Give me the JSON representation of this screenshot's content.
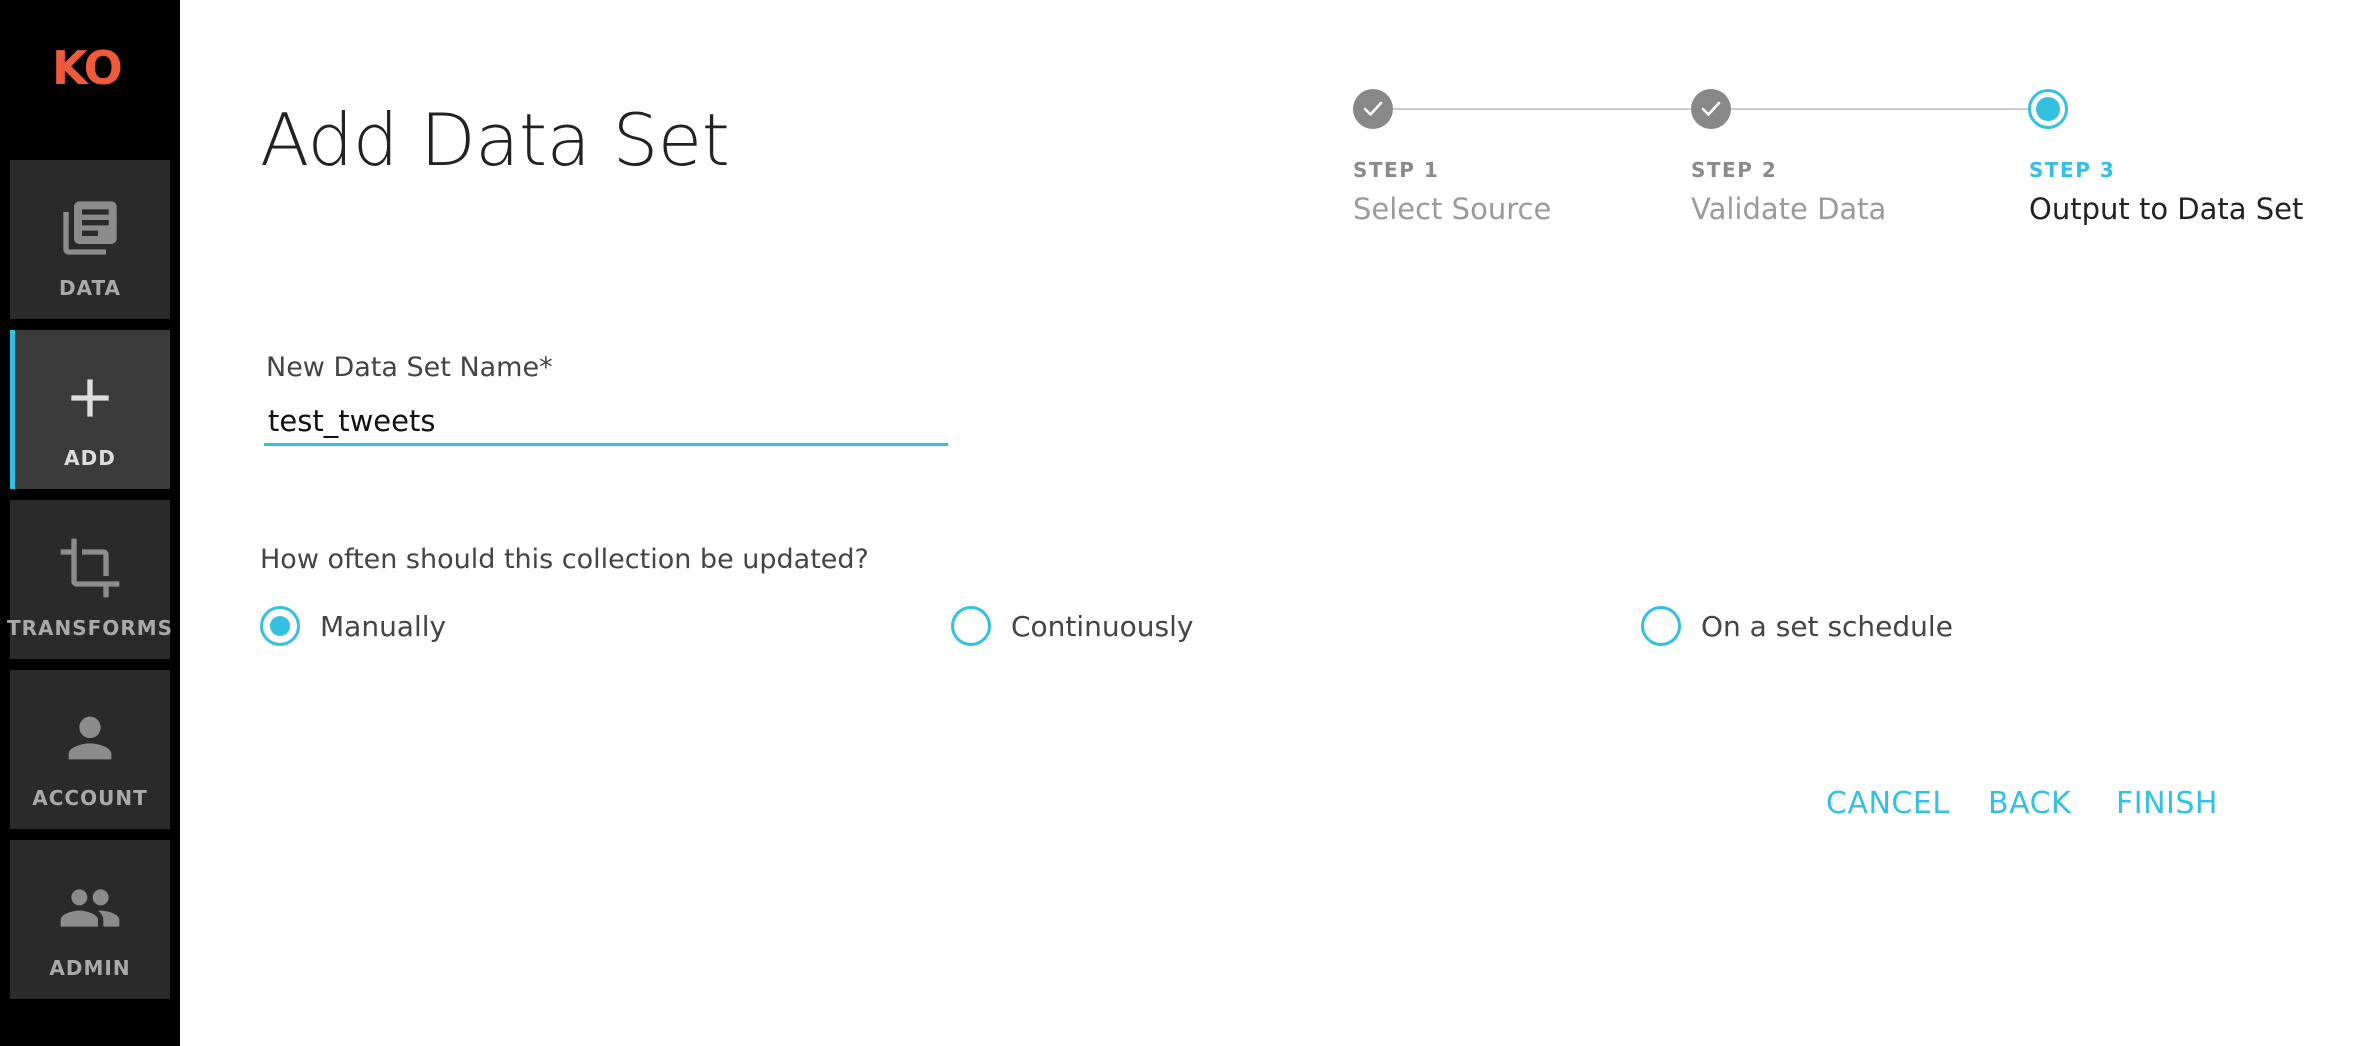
{
  "logo": {
    "text": "KO"
  },
  "sidebar": {
    "items": [
      {
        "label": "DATA",
        "icon": "library-books-icon"
      },
      {
        "label": "ADD",
        "icon": "plus-icon",
        "active": true
      },
      {
        "label": "TRANSFORMS",
        "icon": "crop-icon"
      },
      {
        "label": "ACCOUNT",
        "icon": "person-icon"
      },
      {
        "label": "ADMIN",
        "icon": "people-icon"
      }
    ]
  },
  "page": {
    "title": "Add Data Set"
  },
  "stepper": {
    "steps": [
      {
        "num": "STEP 1",
        "name": "Select Source",
        "state": "done"
      },
      {
        "num": "STEP 2",
        "name": "Validate Data",
        "state": "done"
      },
      {
        "num": "STEP 3",
        "name": "Output to Data Set",
        "state": "current"
      }
    ]
  },
  "form": {
    "name_label": "New Data Set Name*",
    "name_value": "test_tweets",
    "question": "How often should this collection be updated?",
    "options": [
      {
        "label": "Manually",
        "checked": true
      },
      {
        "label": "Continuously",
        "checked": false
      },
      {
        "label": "On a set schedule",
        "checked": false
      }
    ]
  },
  "actions": {
    "cancel": "CANCEL",
    "back": "BACK",
    "finish": "FINISH"
  },
  "colors": {
    "accent": "#34c0e0",
    "brand": "#ef5a3c",
    "sidebar": "#000000"
  }
}
